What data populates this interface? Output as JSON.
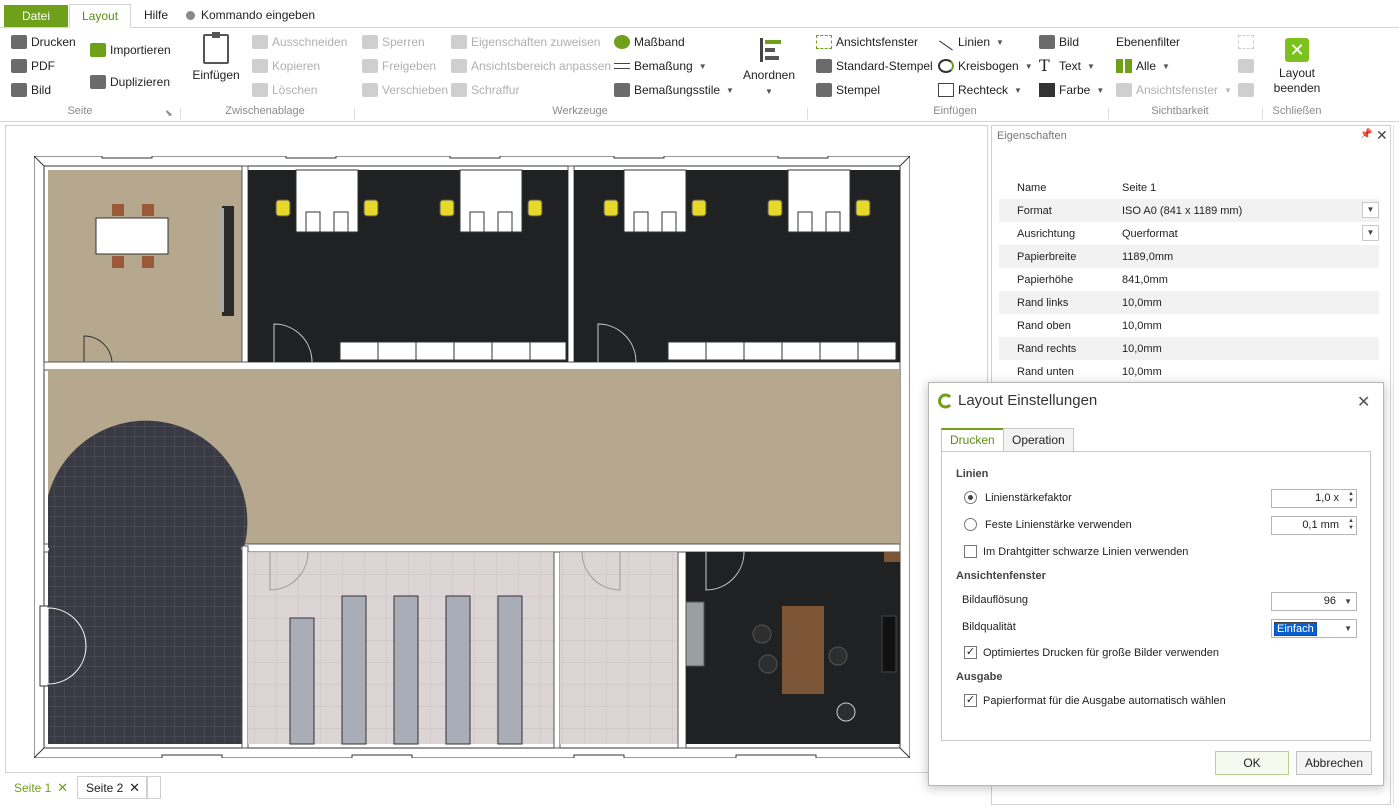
{
  "tabs": {
    "file": "Datei",
    "layout": "Layout",
    "help": "Hilfe",
    "command": "Kommando eingeben"
  },
  "ribbon": {
    "seite": {
      "label": "Seite",
      "print": "Drucken",
      "pdf": "PDF",
      "image": "Bild",
      "import": "Importieren",
      "duplicate": "Duplizieren"
    },
    "clipboard": {
      "label": "Zwischenablage",
      "paste": "Einfügen",
      "cut": "Ausschneiden",
      "copy": "Kopieren",
      "delete": "Löschen"
    },
    "tools": {
      "label": "Werkzeuge",
      "lock": "Sperren",
      "unlock": "Freigeben",
      "move": "Verschieben",
      "assign_props": "Eigenschaften zuweisen",
      "fit_view": "Ansichtsbereich anpassen",
      "hatch": "Schraffur",
      "tape": "Maßband",
      "dimension": "Bemaßung",
      "dim_styles": "Bemaßungsstile",
      "arrange": "Anordnen"
    },
    "insert": {
      "label": "Einfügen",
      "viewport": "Ansichtsfenster",
      "std_stamp": "Standard-Stempel",
      "stamp": "Stempel",
      "lines": "Linien",
      "arc": "Kreisbogen",
      "rect": "Rechteck",
      "image": "Bild",
      "text": "Text",
      "color": "Farbe"
    },
    "visibility": {
      "label": "Sichtbarkeit",
      "layer_filter": "Ebenenfilter",
      "all": "Alle",
      "viewport": "Ansichtsfenster"
    },
    "close": {
      "label": "Schließen",
      "end_layout": "Layout beenden"
    }
  },
  "page_tabs": [
    "Seite 1",
    "Seite 2"
  ],
  "properties": {
    "title": "Eigenschaften",
    "rows": [
      {
        "name": "Name",
        "value": "Seite 1"
      },
      {
        "name": "Format",
        "value": "ISO A0 (841 x 1189 mm)"
      },
      {
        "name": "Ausrichtung",
        "value": "Querformat"
      },
      {
        "name": "Papierbreite",
        "value": "1189,0mm"
      },
      {
        "name": "Papierhöhe",
        "value": "841,0mm"
      },
      {
        "name": "Rand links",
        "value": "10,0mm"
      },
      {
        "name": "Rand oben",
        "value": "10,0mm"
      },
      {
        "name": "Rand rechts",
        "value": "10,0mm"
      },
      {
        "name": "Rand unten",
        "value": "10,0mm"
      }
    ]
  },
  "dialog": {
    "title": "Layout Einstellungen",
    "tabs": [
      "Drucken",
      "Operation"
    ],
    "section_lines": "Linien",
    "line_factor_label": "Linienstärkefaktor",
    "line_factor_value": "1,0 x",
    "fixed_width_label": "Feste Linienstärke verwenden",
    "fixed_width_value": "0,1 mm",
    "wireframe_label": "Im Drahtgitter schwarze Linien verwenden",
    "section_viewport": "Ansichtenfenster",
    "resolution_label": "Bildauflösung",
    "resolution_value": "96",
    "quality_label": "Bildqualität",
    "quality_value": "Einfach",
    "optimized_label": "Optimiertes Drucken für große Bilder verwenden",
    "section_output": "Ausgabe",
    "auto_paper_label": "Papierformat für die Ausgabe automatisch wählen",
    "ok": "OK",
    "cancel": "Abbrechen"
  },
  "colors": {
    "accent": "#6fa01a",
    "floor_beige": "#b5a88f",
    "room_dark": "#1f2123",
    "tile_light": "#ddd5d5"
  }
}
